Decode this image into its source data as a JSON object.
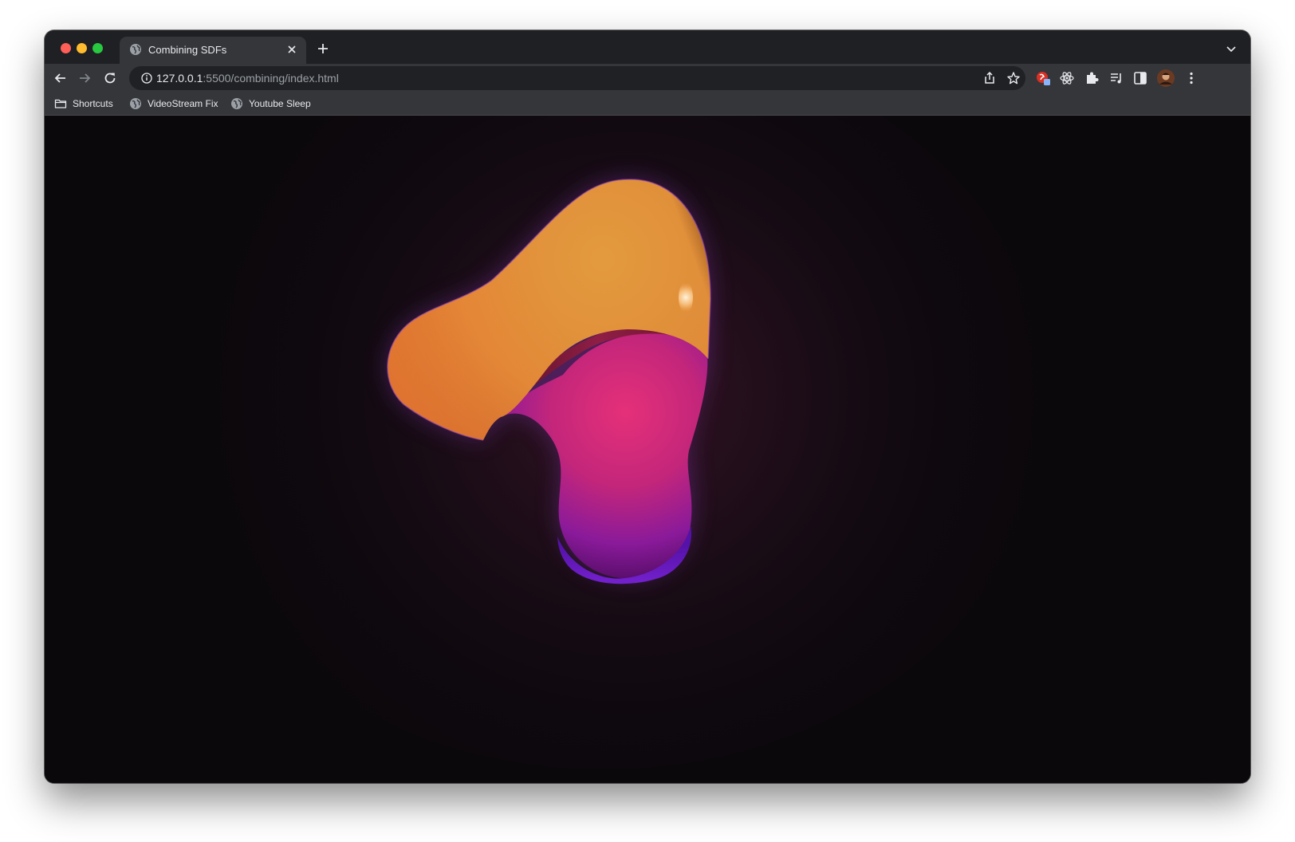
{
  "tab": {
    "title": "Combining SDFs"
  },
  "omnibox": {
    "url_host": "127.0.0.1",
    "url_rest": ":5500/combining/index.html"
  },
  "bookmarks": [
    {
      "label": "Shortcuts",
      "icon": "folder-icon"
    },
    {
      "label": "VideoStream Fix",
      "icon": "globe-icon"
    },
    {
      "label": "Youtube Sleep",
      "icon": "globe-icon"
    }
  ],
  "colors": {
    "background": "#0b080c",
    "blob_orange": "#e0933c",
    "blob_pink": "#e0307a",
    "blob_purple": "#7a20d8"
  }
}
